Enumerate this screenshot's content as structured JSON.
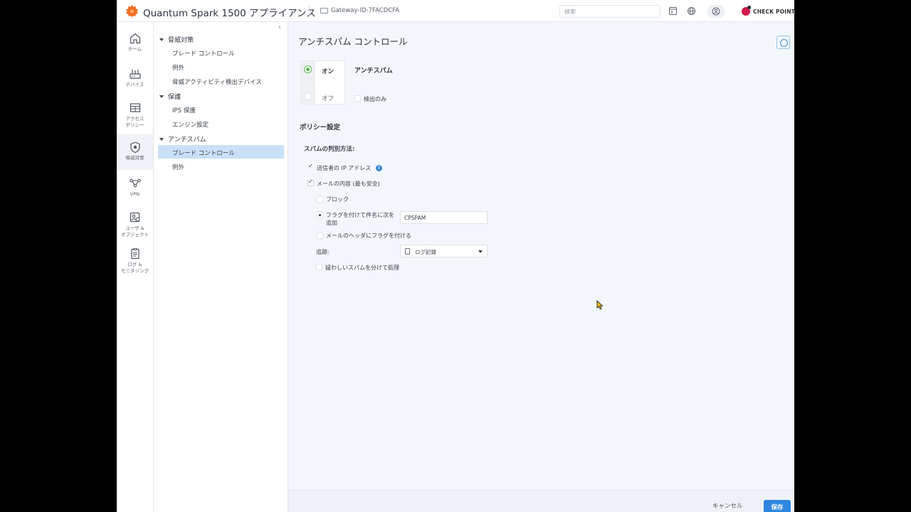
{
  "header": {
    "app_title": "Quantum Spark 1500 アプライアンス",
    "gateway_label": "Gateway-ID-7FACDCFA",
    "search_placeholder": "検索",
    "brand": "CHECK POINT"
  },
  "icon_nav": [
    {
      "label": "ホーム",
      "icon": "home-icon"
    },
    {
      "label": "デバイス",
      "icon": "device-icon"
    },
    {
      "label": "アクセス\nポリシー",
      "icon": "access-policy-icon"
    },
    {
      "label": "脅威対策",
      "icon": "shield-icon",
      "active": true
    },
    {
      "label": "VPN",
      "icon": "vpn-icon"
    },
    {
      "label": "ユーザ &\nオブジェクト",
      "icon": "users-objects-icon"
    },
    {
      "label": "ログ &\nモニタリング",
      "icon": "logs-icon"
    }
  ],
  "tree": {
    "groups": [
      {
        "label": "脅威対策",
        "items": [
          "ブレード コントロール",
          "例外",
          "脅威アクティビティ検出デバイス"
        ]
      },
      {
        "label": "保護",
        "items": [
          "IPS 保護",
          "エンジン設定"
        ]
      },
      {
        "label": "アンチスパム",
        "items": [
          "ブレード コントロール",
          "例外"
        ]
      }
    ]
  },
  "main": {
    "page_title": "アンチスパム コントロール",
    "toggle_on": "オン",
    "toggle_off": "オフ",
    "blade_name": "アンチスパム",
    "detect_only": "検出のみ",
    "policy_title": "ポリシー設定",
    "method_title": "スパムの判別方法:",
    "opt_sender_ip": "送信者の IP アドレス",
    "opt_mail_content": "メールの内容 (最も安全)",
    "action_block": "ブロック",
    "action_flag_subject_line1": "フラグを付けて件名に次を",
    "action_flag_subject_line2": "追加",
    "flag_text_value": "CPSPAM",
    "action_flag_header": "メールのヘッダにフラグを付ける",
    "track_label": "追跡:",
    "track_value": "ログ記録",
    "suspicious_label": "疑わしいスパムを分けて処理"
  },
  "footer": {
    "cancel_label": "キャンセル",
    "save_label": "保存"
  },
  "colors": {
    "accent": "#2e86de",
    "selected": "#c8e0f8",
    "on_green": "#52b848",
    "brand_red": "#d11a4e",
    "logo_orange": "#f26b21"
  }
}
